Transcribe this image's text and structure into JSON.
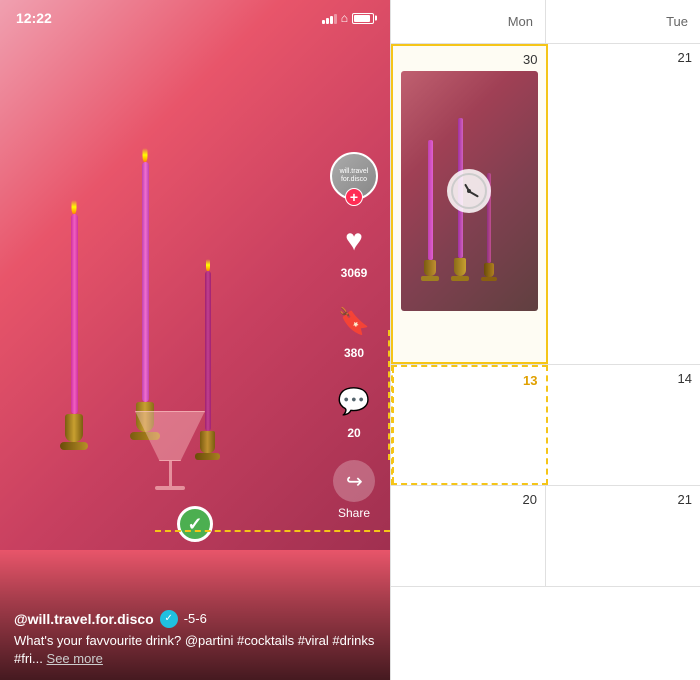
{
  "phone": {
    "status": {
      "time": "12:22",
      "lightning": "↗"
    },
    "actions": {
      "like_count": "3069",
      "bookmark_count": "380",
      "comment_count": "20",
      "share_label": "Share"
    },
    "caption": {
      "username": "@will.travel.for.disco",
      "score": "-5-6",
      "text": "What's your favvourite drink? @partini\n#cocktails #viral #drinks #fri...",
      "see_more": "See more"
    },
    "avatar_text": "will.travel\nfor.disco"
  },
  "calendar": {
    "days": [
      "Mon",
      "Tue"
    ],
    "dates_row1": [
      "30",
      "21"
    ],
    "dates_row2": [
      "13",
      "14"
    ],
    "dates_row3": [
      "20",
      "21"
    ],
    "highlighted_date": "13"
  }
}
